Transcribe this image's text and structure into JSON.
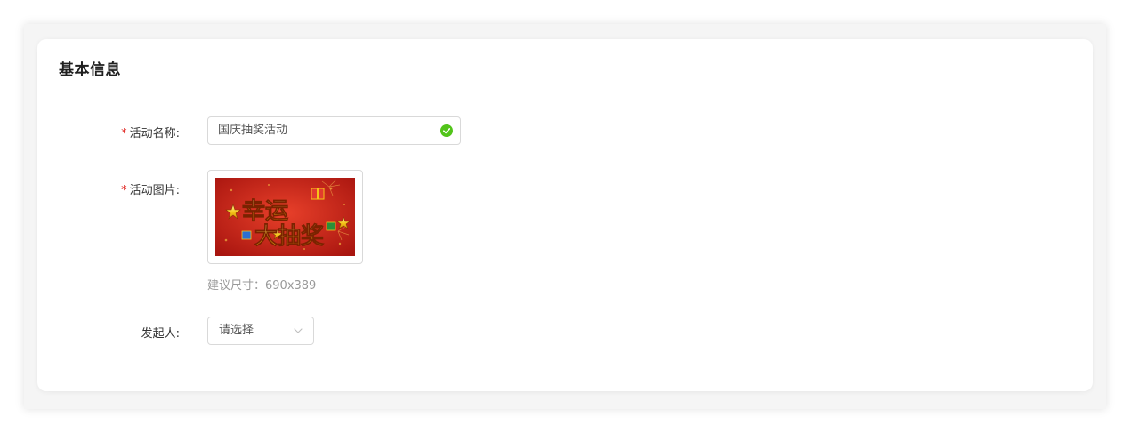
{
  "section": {
    "title": "基本信息"
  },
  "form": {
    "required_mark": "*",
    "activity_name": {
      "label": "活动名称:",
      "value": "国庆抽奖活动",
      "status_icon": "check-circle-icon",
      "status_color": "#52c41a"
    },
    "activity_image": {
      "label": "活动图片:",
      "banner_line1": "幸运",
      "banner_line2": "大抽奖",
      "hint": "建议尺寸：690x389"
    },
    "initiator": {
      "label": "发起人:",
      "placeholder": "请选择",
      "dropdown_icon": "chevron-down-icon"
    }
  },
  "colors": {
    "required": "#e0201b",
    "success": "#52c41a",
    "banner_red": "#c81d1d",
    "banner_gold": "#f5c518"
  }
}
